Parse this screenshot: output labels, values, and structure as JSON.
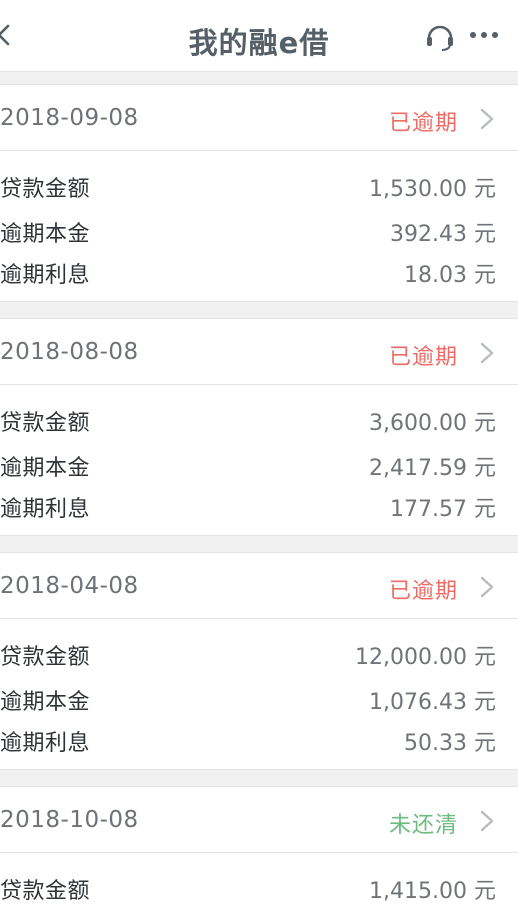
{
  "nav": {
    "title": "我的融e借",
    "back_icon": "chevron-left-icon",
    "support_icon": "headset-icon",
    "more_icon": "more-dots-icon"
  },
  "colors": {
    "overdue": "#ec6b64",
    "unpaid": "#6dbb7e",
    "label": "#2f3337",
    "value": "#707478"
  },
  "loans": [
    {
      "date": "2018-09-08",
      "status": "已逾期",
      "status_type": "overdue",
      "rows": [
        {
          "label": "贷款金额",
          "value": "1,530.00 元"
        },
        {
          "label": "逾期本金",
          "value": "392.43 元"
        },
        {
          "label": "逾期利息",
          "value": "18.03 元"
        }
      ]
    },
    {
      "date": "2018-08-08",
      "status": "已逾期",
      "status_type": "overdue",
      "rows": [
        {
          "label": "贷款金额",
          "value": "3,600.00 元"
        },
        {
          "label": "逾期本金",
          "value": "2,417.59 元"
        },
        {
          "label": "逾期利息",
          "value": "177.57 元"
        }
      ]
    },
    {
      "date": "2018-04-08",
      "status": "已逾期",
      "status_type": "overdue",
      "rows": [
        {
          "label": "贷款金额",
          "value": "12,000.00 元"
        },
        {
          "label": "逾期本金",
          "value": "1,076.43 元"
        },
        {
          "label": "逾期利息",
          "value": "50.33 元"
        }
      ]
    },
    {
      "date": "2018-10-08",
      "status": "未还清",
      "status_type": "unpaid",
      "rows": [
        {
          "label": "贷款金额",
          "value": "1,415.00 元"
        }
      ]
    }
  ]
}
